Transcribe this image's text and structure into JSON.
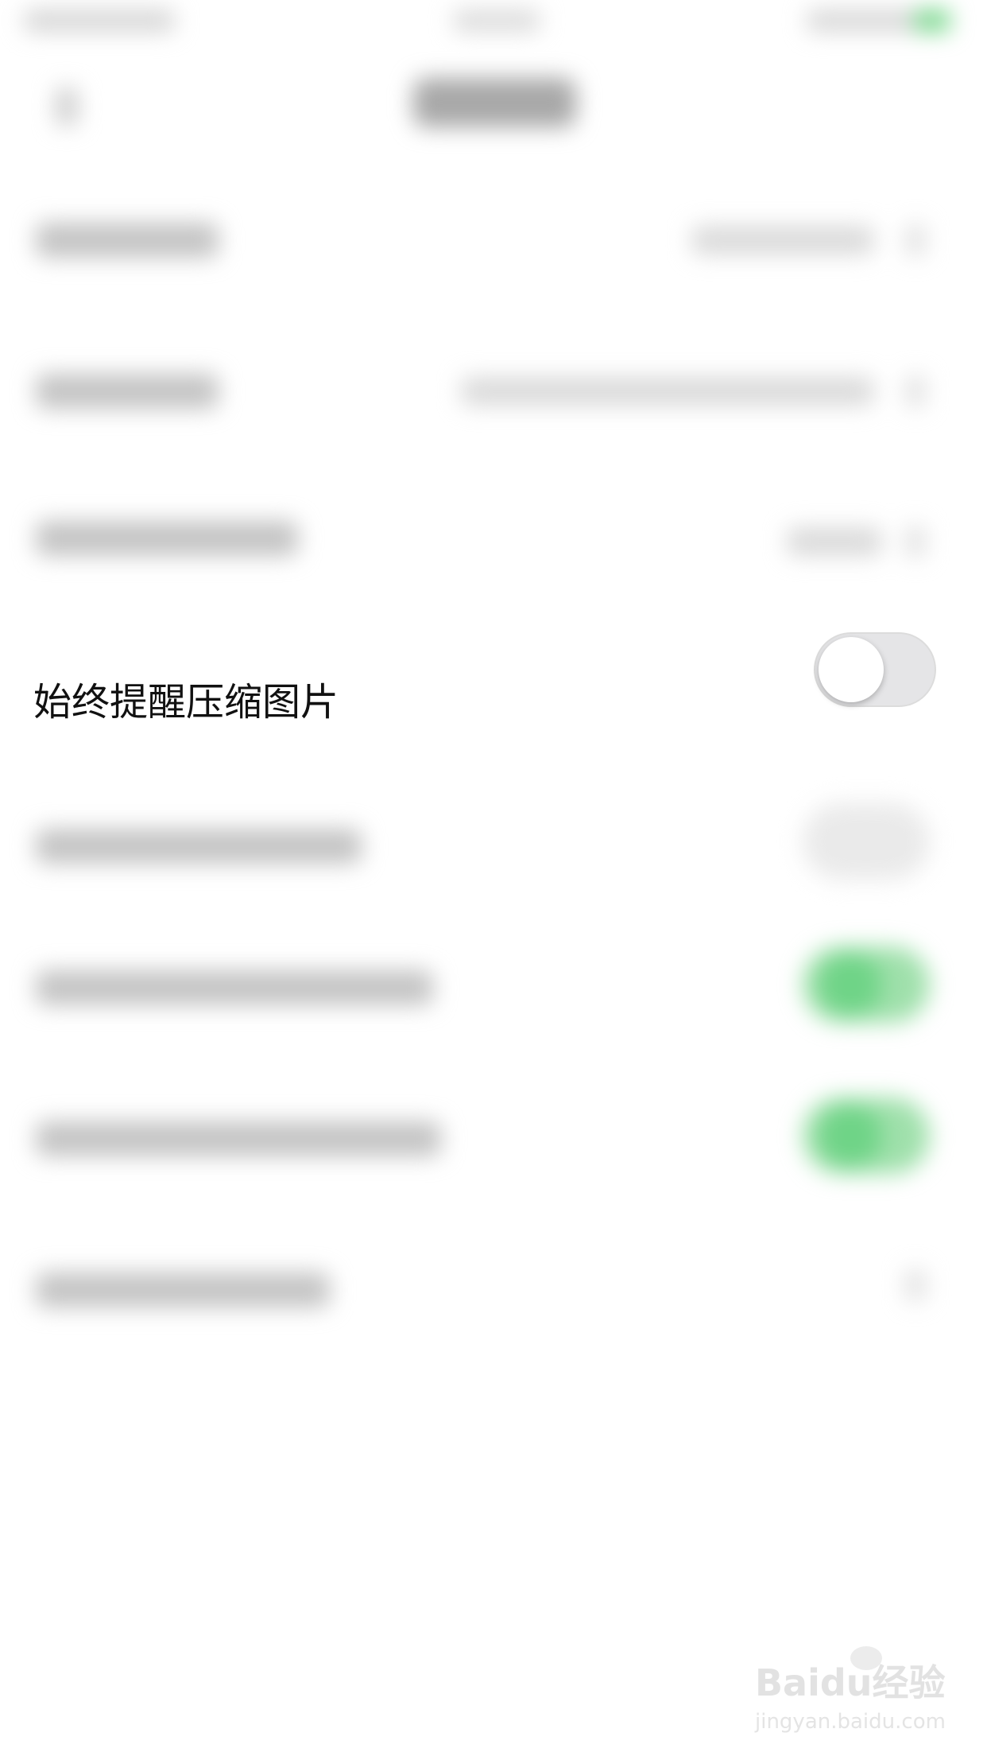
{
  "setting_row": {
    "label": "始终提醒压缩图片",
    "toggle_on": false
  },
  "colors": {
    "toggle_off_track": "#e5e5e7",
    "toggle_on_green": "#6fd487",
    "label_text": "#111111"
  },
  "watermark": {
    "brand": "Baidu经验",
    "url": "jingyan.baidu.com"
  }
}
